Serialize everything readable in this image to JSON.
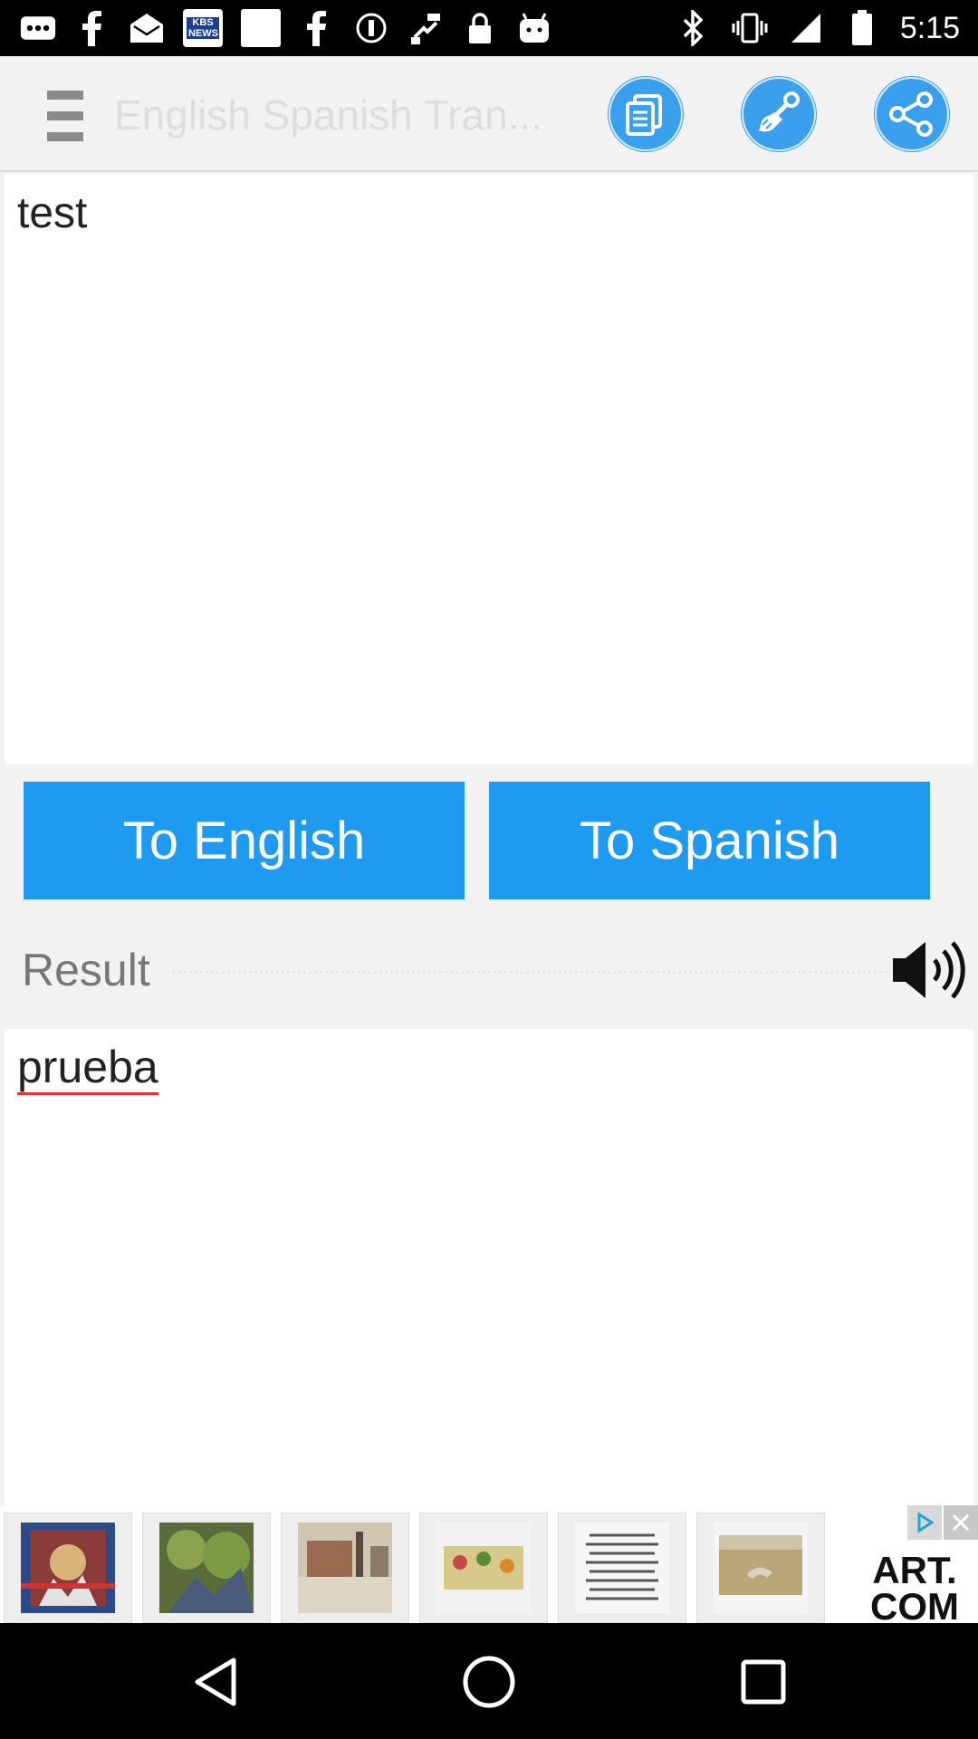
{
  "status_bar": {
    "time": "5:15",
    "kbs_label": "KBS",
    "news_label": "NEWS",
    "icons": [
      "more-icon",
      "facebook-icon",
      "email-icon",
      "kbs-news-icon",
      "square-icon",
      "facebook-icon",
      "dnd-icon",
      "fake-gps-icon",
      "lock-icon",
      "android-icon",
      "bluetooth-icon",
      "vibrate-icon",
      "signal-icon",
      "battery-icon"
    ]
  },
  "app_bar": {
    "title": "English Spanish Tran...",
    "menu_icon": "menu-icon",
    "buttons": [
      "copy-icon",
      "brush-icon",
      "share-icon"
    ]
  },
  "input": {
    "text": "test"
  },
  "buttons": {
    "to_english": "To English",
    "to_spanish": "To Spanish"
  },
  "result": {
    "label": "Result",
    "text": "prueba",
    "speaker_icon": "speaker-icon"
  },
  "ad": {
    "logo_line1": "ART.",
    "logo_line2": "COM"
  },
  "nav": {
    "buttons": [
      "back-icon",
      "home-icon",
      "recents-icon"
    ]
  },
  "colors": {
    "accent": "#1e9bf0",
    "icon_circle": "#3aa0ee",
    "background": "#f2f2f2",
    "spellcheck_underline": "#e8323c"
  }
}
